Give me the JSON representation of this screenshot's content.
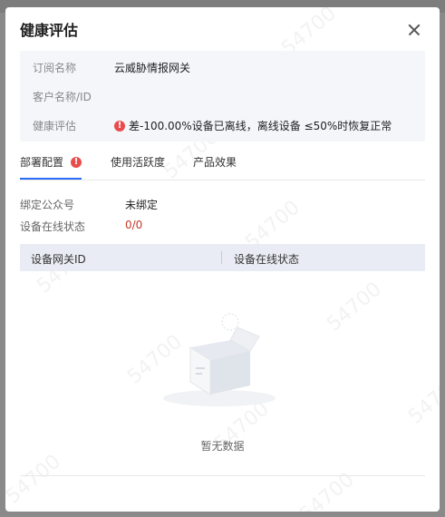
{
  "modal": {
    "title": "健康评估",
    "close_icon": "close-icon"
  },
  "info": {
    "subscription_label": "订阅名称",
    "subscription_value": "云威胁情报网关",
    "customer_label": "客户名称/ID",
    "customer_value": "",
    "health_label": "健康评估",
    "health_value": "差-100.00%设备已离线，离线设备 ≤50%时恢复正常",
    "health_icon": "error-icon"
  },
  "tabs": [
    {
      "label": "部署配置",
      "active": true,
      "has_alert": true
    },
    {
      "label": "使用活跃度",
      "active": false
    },
    {
      "label": "产品效果",
      "active": false
    }
  ],
  "deploy": {
    "official_account_label": "绑定公众号",
    "official_account_value": "未绑定",
    "device_online_label": "设备在线状态",
    "device_online_value": "0/0"
  },
  "table": {
    "columns": [
      "设备网关ID",
      "设备在线状态"
    ],
    "empty_text": "暂无数据",
    "empty_icon": "empty-box-icon"
  },
  "watermark": "54700",
  "colors": {
    "accent": "#2b6cf6",
    "error": "#e84c4c",
    "info_bg": "#f4f6fa",
    "table_head_bg": "#e9ecf4"
  }
}
